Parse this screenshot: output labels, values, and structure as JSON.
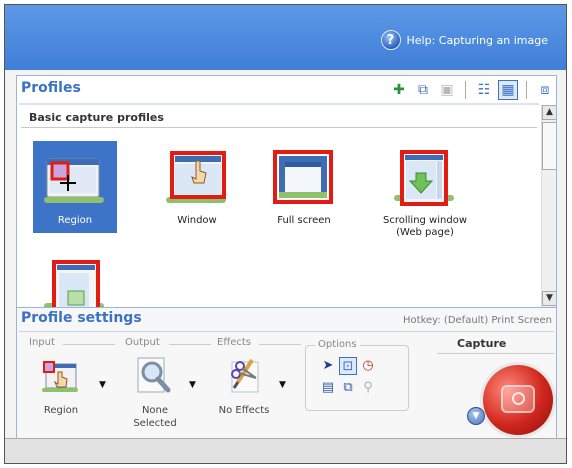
{
  "header": {
    "help_text": "Help: Capturing an image",
    "help_glyph": "?"
  },
  "profiles": {
    "title": "Profiles",
    "toolbar": [
      {
        "name": "add-profile-button",
        "icon": "plus-icon",
        "glyph": "✚",
        "color": "#2f8f3a"
      },
      {
        "name": "duplicate-profile-button",
        "icon": "copy-icon",
        "glyph": "⧉",
        "color": "#3a72c4"
      },
      {
        "name": "save-profile-button",
        "icon": "disk-icon",
        "glyph": "▣",
        "color": "#b8b8b8"
      },
      {
        "name": "details-view-button",
        "icon": "list-view-icon",
        "glyph": "☷",
        "color": "#3a72c4"
      },
      {
        "name": "thumbnail-view-button",
        "icon": "tile-view-icon",
        "glyph": "▦",
        "color": "#3a72c4"
      },
      {
        "name": "manage-profiles-button",
        "icon": "settings-grid-icon",
        "glyph": "⧈",
        "color": "#3a72c4"
      }
    ],
    "group": "Basic capture profiles",
    "items": [
      {
        "label": "Region",
        "selected": true,
        "icon": "region-capture-icon"
      },
      {
        "label": "Window",
        "selected": false,
        "icon": "window-capture-icon"
      },
      {
        "label": "Full screen",
        "selected": false,
        "icon": "fullscreen-capture-icon"
      },
      {
        "label": "Scrolling window (Web page)",
        "selected": false,
        "icon": "scrolling-window-icon"
      },
      {
        "label": "",
        "selected": false,
        "icon": "partial-profile-icon"
      }
    ],
    "scroll_up": "▲",
    "scroll_down": "▼"
  },
  "settings": {
    "title": "Profile settings",
    "hotkey": "Hotkey: (Default) Print Screen",
    "columns": {
      "input": "Input",
      "output": "Output",
      "effects": "Effects",
      "options": "Options",
      "capture": "Capture"
    },
    "input_value": "Region",
    "output_value": "None Selected",
    "effects_value": "No Effects",
    "dropdown_glyph": "▼",
    "options": [
      {
        "name": "pointer-option",
        "icon": "cursor-icon",
        "glyph": "➤",
        "selected": false
      },
      {
        "name": "preview-option",
        "icon": "preview-icon",
        "glyph": "⊡",
        "selected": true
      },
      {
        "name": "timer-option",
        "icon": "timer-icon",
        "glyph": "◷",
        "selected": false
      },
      {
        "name": "multiple-area-option",
        "icon": "multi-area-icon",
        "glyph": "▤",
        "selected": false
      },
      {
        "name": "copy-clipboard-option",
        "icon": "clipboard-icon",
        "glyph": "⧉",
        "selected": false
      },
      {
        "name": "share-option",
        "icon": "share-icon",
        "glyph": "⚲",
        "selected": false
      }
    ]
  },
  "colors": {
    "accent": "#3a72c4",
    "selected_bg": "#3e74c8",
    "highlight_red": "#e21c12"
  }
}
